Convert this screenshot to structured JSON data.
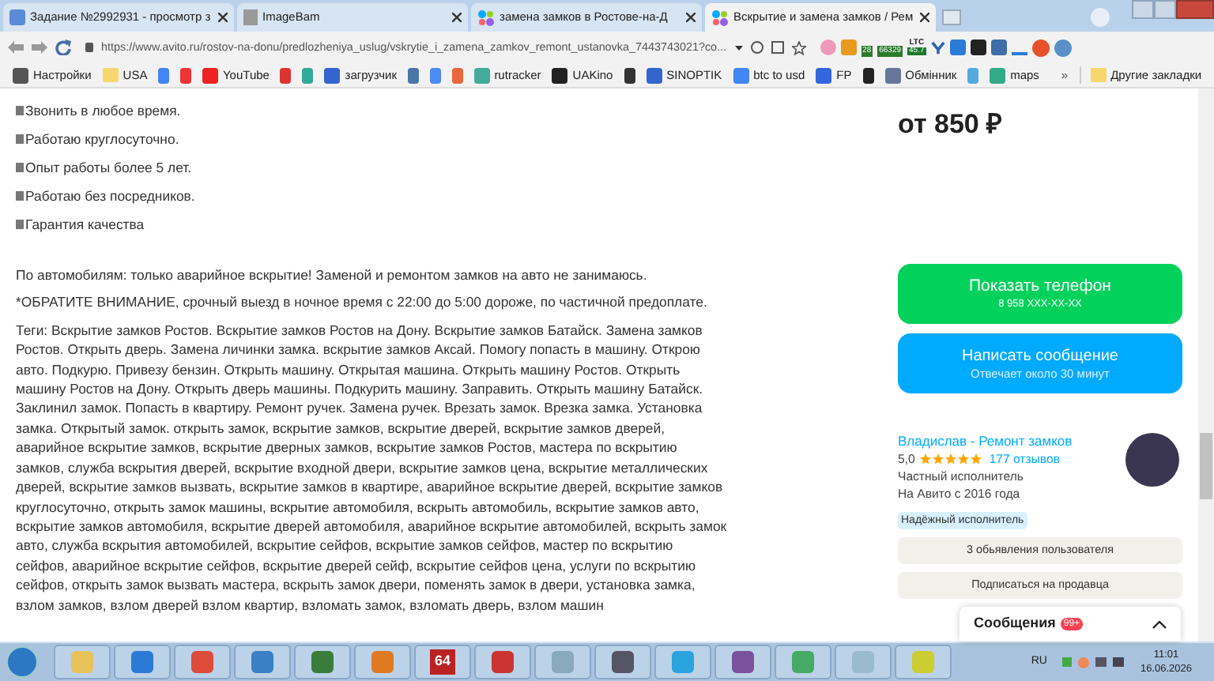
{
  "browser_tabs": [
    {
      "title": "Задание №2992931 - просмотр з",
      "selected": false
    },
    {
      "title": "ImageBam",
      "selected": false
    },
    {
      "title": "замена замков в Ростове-на-Д",
      "selected": false
    },
    {
      "title": "Вскрытие и замена замков / Рем",
      "selected": true
    }
  ],
  "address_bar": {
    "url": "https://www.avito.ru/rostov-na-donu/predlozheniya_uslug/vskrytie_i_zamena_zamkov_remont_ustanovka_7443743021?co..."
  },
  "extension_badges": [
    {
      "kind": "badge",
      "text": "28"
    },
    {
      "kind": "badge",
      "text": "66329"
    },
    {
      "kind": "ltc",
      "text": "LTC",
      "value": "45.7"
    }
  ],
  "bookmarks": [
    {
      "kind": "labeled",
      "label": "Настройки"
    },
    {
      "kind": "folder",
      "label": "USA"
    },
    {
      "kind": "icon"
    },
    {
      "kind": "icon"
    },
    {
      "kind": "labeled",
      "label": "YouTube"
    },
    {
      "kind": "icon"
    },
    {
      "kind": "icon"
    },
    {
      "kind": "labeled",
      "label": "загрузчик"
    },
    {
      "kind": "icon"
    },
    {
      "kind": "icon"
    },
    {
      "kind": "icon"
    },
    {
      "kind": "labeled",
      "label": "rutracker"
    },
    {
      "kind": "labeled",
      "label": "UAKino"
    },
    {
      "kind": "icon"
    },
    {
      "kind": "labeled",
      "label": "SINOPTIK"
    },
    {
      "kind": "labeled",
      "label": "btc to usd"
    },
    {
      "kind": "labeled",
      "label": "FP"
    },
    {
      "kind": "icon"
    },
    {
      "kind": "labeled",
      "label": "Обмінник"
    },
    {
      "kind": "icon"
    },
    {
      "kind": "labeled",
      "label": "maps"
    }
  ],
  "bookmarks_more": "»",
  "other_bookmarks": "Другие закладки",
  "features": [
    "Звонить в любое время.",
    "Работаю круглосуточно.",
    "Опыт работы более 5 лет.",
    "Работаю без посредников.",
    "Гарантия качества"
  ],
  "paragraphs": [
    "По автомобилям: только аварийное вскрытие! Заменой и ремонтом замков на авто не занимаюсь.",
    "*ОБРАТИТЕ ВНИМАНИЕ, срочный выезд в ночное время с 22:00 до 5:00 дороже, по частичной предоплате.",
    "Теги: Вскрытие замков Ростов. Вскрытие замков Ростов на Дону. Вскрытие замков Батайск. Замена замков Ростов. Открыть дверь. Замена личинки замка. вскрытие замков Аксай. Помогу попасть в машину. Открою авто. Подкурю. Привезу бензин. Открыть машину. Открытая машина. Открыть машину Ростов. Открыть машину Ростов на Дону. Открыть дверь машины. Подкурить машину. Заправить. Открыть машину Батайск. Заклинил замок. Попасть в квартиру. Ремонт ручек. Замена ручек. Врезать замок. Врезка замка. Установка замка. Открытый замок. открыть замок, вскрытие замков, вскрытие дверей, вскрытие замков дверей, аварийное вскрытие замков, вскрытие дверных замков, вскрытие замков Ростов, мастера по вскрытию замков, служба вскрытия дверей, вскрытие входной двери, вскрытие замков цена, вскрытие металлических дверей, вскрытие замков вызвать, вскрытие замков в квартире, аварийное вскрытие дверей, вскрытие замков круглосуточно, открыть замок машины, вскрытие автомобиля, вскрыть автомобиль, вскрытие замков авто, вскрытие замков автомобиля, вскрытие дверей автомобиля, аварийное вскрытие автомобилей, вскрыть замок авто, служба вскрытия автомобилей, вскрытие сейфов, вскрытие замков сейфов, мастер по вскрытию сейфов, аварийное вскрытие сейфов, вскрытие дверей сейф, вскрытие сейфов цена, услуги по вскрытию сейфов, открыть замок вызвать мастера, вскрыть замок двери, поменять замок в двери, установка замка, взлом замков, взлом дверей взлом квартир, взломать замок, взломать дверь, взлом машин"
  ],
  "price": "от 850 ₽",
  "phone_button": {
    "label": "Показать телефон",
    "sub": "8 958 XXX-XX-XX"
  },
  "message_button": {
    "label": "Написать сообщение",
    "sub": "Отвечает около 30 минут"
  },
  "seller": {
    "name": "Владислав - Ремонт замков",
    "rating": "5,0",
    "stars": 5,
    "reviews": "177 отзывов",
    "type": "Частный исполнитель",
    "since": "На Авито с 2016 года",
    "badge": "Надёжный исполнитель"
  },
  "seller_buttons": [
    "3 обьявления пользователя",
    "Подписаться на продавца"
  ],
  "messages_panel": {
    "title": "Сообщения",
    "count": "99+"
  },
  "taskbar": {
    "language": "RU",
    "time": "11:01",
    "date": "16.06.2026",
    "app_label": "64"
  }
}
